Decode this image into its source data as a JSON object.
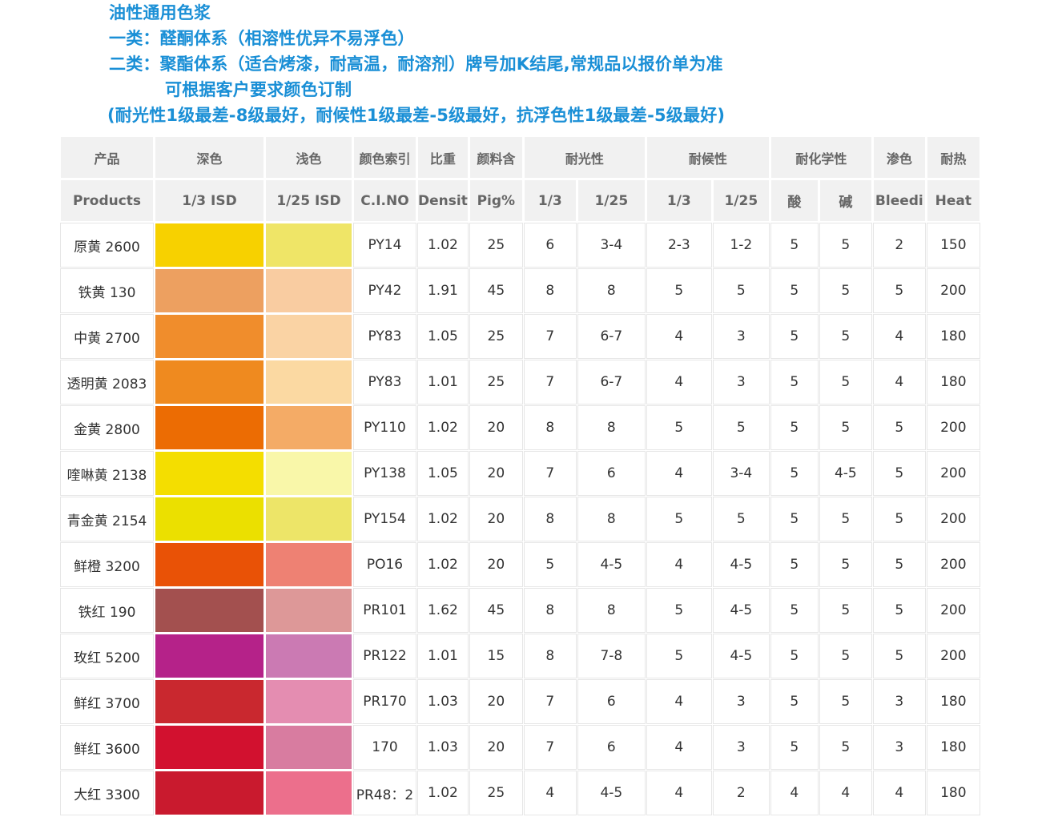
{
  "header": {
    "line1": "油性通用色浆",
    "line2": "一类：醛酮体系（相溶性优异不易浮色）",
    "line3": "二类：聚酯体系（适合烤漆，耐高温，耐溶剂）牌号加K结尾,常规品以报价单为准",
    "line4": "可根据客户要求颜色订制",
    "line5": "(耐光性1级最差-8级最好，耐候性1级最差-5级最好，抗浮色性1级最差-5级最好)"
  },
  "table": {
    "headers_cn": {
      "product": "产品",
      "deep": "深色",
      "light": "浅色",
      "ci": "颜色索引",
      "density": "比重",
      "pigment": "颜料含",
      "lightfast": "耐光性",
      "weather": "耐候性",
      "chemical": "耐化学性",
      "bleed": "渗色",
      "heat": "耐热"
    },
    "headers_en": {
      "product": "Products",
      "deep": "1/3 ISD",
      "light": "1/25 ISD",
      "ci": "C.I.NO",
      "density": "Densit",
      "pigment": "Pig%",
      "lf_13": "1/3",
      "lf_125": "1/25",
      "w_13": "1/3",
      "w_125": "1/25",
      "acid": "酸",
      "alkali": "碱",
      "bleed": "Bleedi",
      "heat": "Heat"
    },
    "rows": [
      {
        "name": "原黄 2600",
        "deep_color": "#f7d100",
        "light_color": "#efe567",
        "ci": "PY14",
        "density": "1.02",
        "pig": "25",
        "lf13": "6",
        "lf125": "3-4",
        "w13": "2-3",
        "w125": "1-2",
        "acid": "5",
        "alkali": "5",
        "bleed": "2",
        "heat": "150"
      },
      {
        "name": "铁黄 130",
        "deep_color": "#eda060",
        "light_color": "#f9cca1",
        "ci": "PY42",
        "density": "1.91",
        "pig": "45",
        "lf13": "8",
        "lf125": "8",
        "w13": "5",
        "w125": "5",
        "acid": "5",
        "alkali": "5",
        "bleed": "5",
        "heat": "200"
      },
      {
        "name": "中黄 2700",
        "deep_color": "#f08d2c",
        "light_color": "#fad3a4",
        "ci": "PY83",
        "density": "1.05",
        "pig": "25",
        "lf13": "7",
        "lf125": "6-7",
        "w13": "4",
        "w125": "3",
        "acid": "5",
        "alkali": "5",
        "bleed": "4",
        "heat": "180"
      },
      {
        "name": "透明黄 2083",
        "deep_color": "#ef8a1f",
        "light_color": "#fbd9a2",
        "ci": "PY83",
        "density": "1.01",
        "pig": "25",
        "lf13": "7",
        "lf125": "6-7",
        "w13": "4",
        "w125": "3",
        "acid": "5",
        "alkali": "5",
        "bleed": "4",
        "heat": "180"
      },
      {
        "name": "金黄 2800",
        "deep_color": "#ec6c03",
        "light_color": "#f4ab66",
        "ci": "PY110",
        "density": "1.02",
        "pig": "20",
        "lf13": "8",
        "lf125": "8",
        "w13": "5",
        "w125": "5",
        "acid": "5",
        "alkali": "5",
        "bleed": "5",
        "heat": "200"
      },
      {
        "name": "喹啉黄 2138",
        "deep_color": "#f4de00",
        "light_color": "#f9f7a9",
        "ci": "PY138",
        "density": "1.05",
        "pig": "20",
        "lf13": "7",
        "lf125": "6",
        "w13": "4",
        "w125": "3-4",
        "acid": "5",
        "alkali": "4-5",
        "bleed": "5",
        "heat": "200"
      },
      {
        "name": "青金黄 2154",
        "deep_color": "#ebe000",
        "light_color": "#ede568",
        "ci": "PY154",
        "density": "1.02",
        "pig": "20",
        "lf13": "8",
        "lf125": "8",
        "w13": "5",
        "w125": "5",
        "acid": "5",
        "alkali": "5",
        "bleed": "5",
        "heat": "200"
      },
      {
        "name": "鲜橙 3200",
        "deep_color": "#e95206",
        "light_color": "#ee8173",
        "ci": "PO16",
        "density": "1.02",
        "pig": "20",
        "lf13": "5",
        "lf125": "4-5",
        "w13": "4",
        "w125": "4-5",
        "acid": "5",
        "alkali": "5",
        "bleed": "5",
        "heat": "200"
      },
      {
        "name": "铁红 190",
        "deep_color": "#a3504f",
        "light_color": "#dd9898",
        "ci": "PR101",
        "density": "1.62",
        "pig": "45",
        "lf13": "8",
        "lf125": "8",
        "w13": "5",
        "w125": "4-5",
        "acid": "5",
        "alkali": "5",
        "bleed": "5",
        "heat": "200"
      },
      {
        "name": "玫红 5200",
        "deep_color": "#b52289",
        "light_color": "#cb7ab3",
        "ci": "PR122",
        "density": "1.01",
        "pig": "15",
        "lf13": "8",
        "lf125": "7-8",
        "w13": "5",
        "w125": "4-5",
        "acid": "5",
        "alkali": "5",
        "bleed": "5",
        "heat": "200"
      },
      {
        "name": "鲜红 3700",
        "deep_color": "#c9282f",
        "light_color": "#e48db1",
        "ci": "PR170",
        "density": "1.03",
        "pig": "20",
        "lf13": "7",
        "lf125": "6",
        "w13": "4",
        "w125": "3",
        "acid": "5",
        "alkali": "5",
        "bleed": "3",
        "heat": "180"
      },
      {
        "name": "鲜红 3600",
        "deep_color": "#d2112f",
        "light_color": "#d87ca0",
        "ci": "170",
        "density": "1.03",
        "pig": "20",
        "lf13": "7",
        "lf125": "6",
        "w13": "4",
        "w125": "3",
        "acid": "5",
        "alkali": "5",
        "bleed": "3",
        "heat": "180"
      },
      {
        "name": "大红 3300",
        "deep_color": "#c91a2e",
        "light_color": "#ec6f8c",
        "ci": "PR48：2",
        "density": "1.02",
        "pig": "25",
        "lf13": "4",
        "lf125": "4-5",
        "w13": "4",
        "w125": "2",
        "acid": "4",
        "alkali": "4",
        "bleed": "4",
        "heat": "180"
      }
    ]
  }
}
